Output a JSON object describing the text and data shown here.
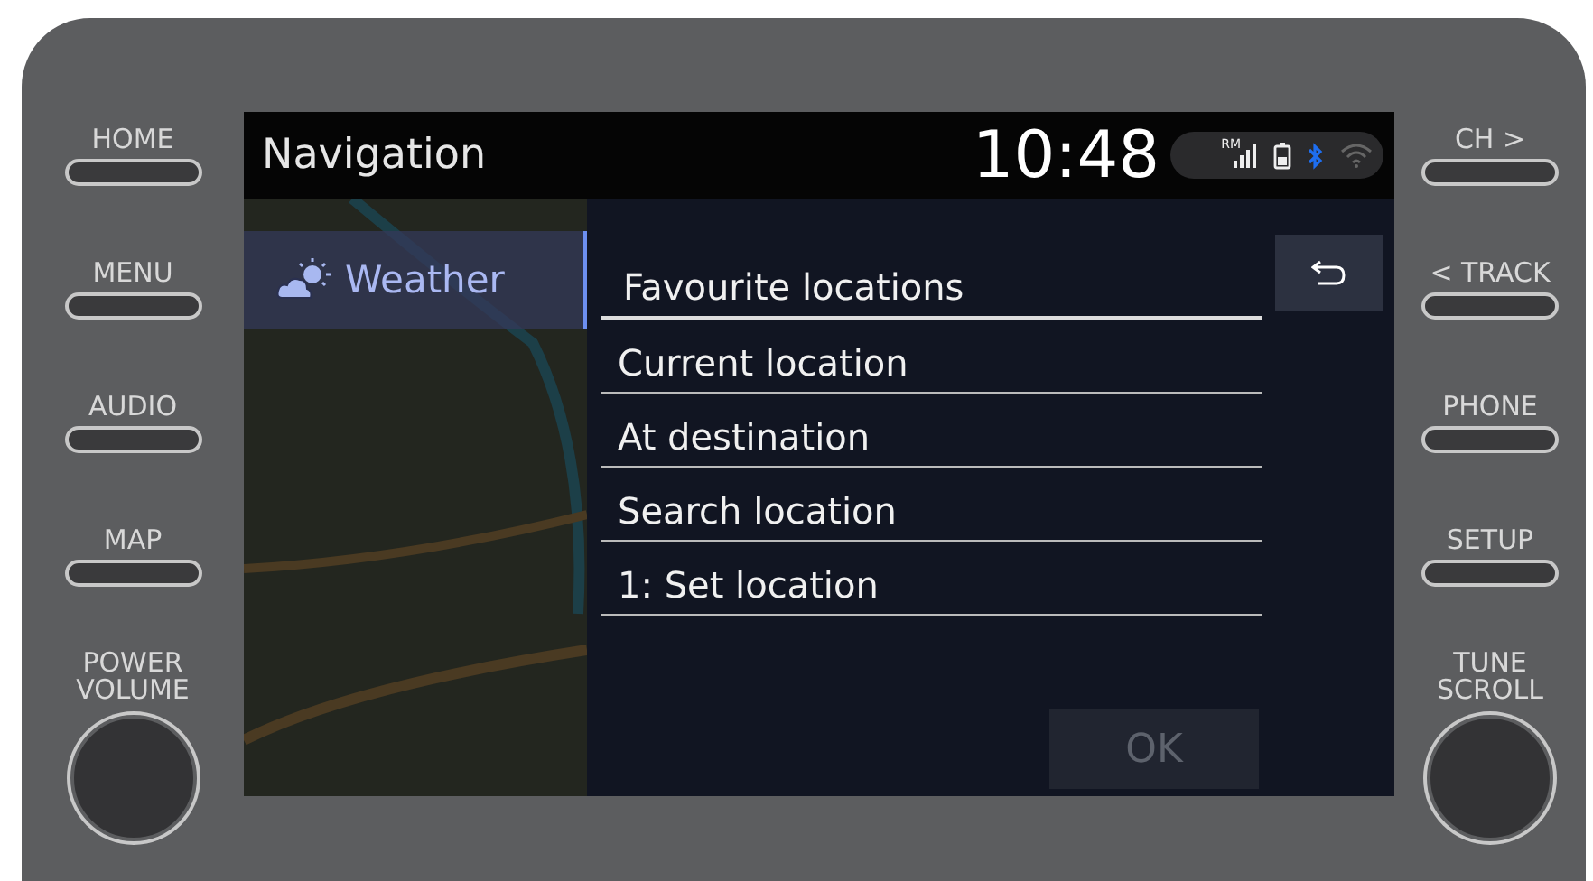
{
  "left_buttons": [
    {
      "label": "HOME"
    },
    {
      "label": "MENU"
    },
    {
      "label": "AUDIO"
    },
    {
      "label": "MAP"
    }
  ],
  "left_knob": {
    "label_lines": [
      "POWER",
      "VOLUME"
    ]
  },
  "right_buttons": [
    {
      "label": "CH >"
    },
    {
      "label": "< TRACK"
    },
    {
      "label": "PHONE"
    },
    {
      "label": "SETUP"
    }
  ],
  "right_knob": {
    "label_lines": [
      "TUNE",
      "SCROLL"
    ]
  },
  "header": {
    "title": "Navigation",
    "time": "10:48",
    "signal_label": "RM"
  },
  "sidebar": {
    "items": [
      {
        "label": "Weather",
        "selected": true
      }
    ]
  },
  "list": {
    "items": [
      {
        "label": "Favourite locations",
        "selected": true
      },
      {
        "label": "Current location",
        "selected": false
      },
      {
        "label": "At destination",
        "selected": false
      },
      {
        "label": "Search location",
        "selected": false
      },
      {
        "label": "1: Set location",
        "selected": false
      }
    ]
  },
  "ok_button": {
    "label": "OK",
    "disabled": true
  }
}
